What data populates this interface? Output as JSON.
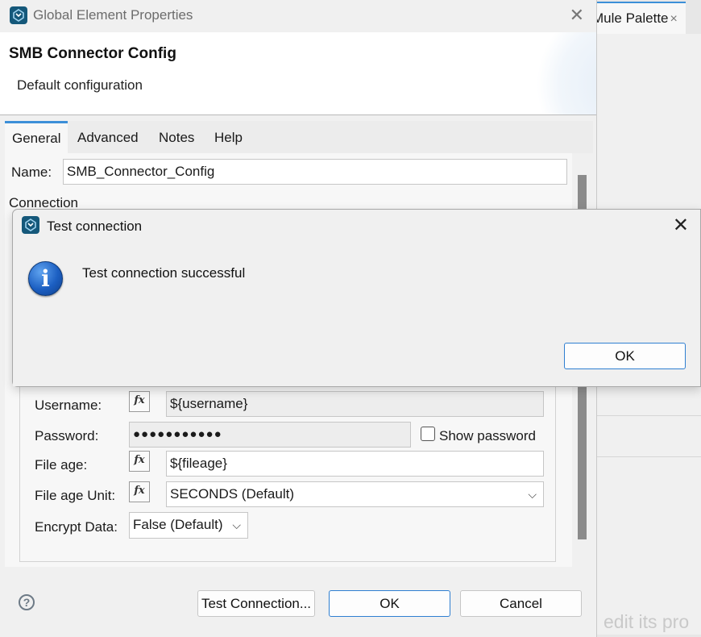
{
  "background": {
    "tab_label": "Mule Palette",
    "tab_close": "×",
    "watermark_text": "edit its pro"
  },
  "main_dialog": {
    "title": "Global Element Properties",
    "close_glyph": "✕",
    "header_title": "SMB Connector Config",
    "header_subtitle": "Default configuration",
    "tabs": [
      {
        "label": "General",
        "active": true
      },
      {
        "label": "Advanced",
        "active": false
      },
      {
        "label": "Notes",
        "active": false
      },
      {
        "label": "Help",
        "active": false
      }
    ],
    "name_label": "Name:",
    "name_value": "SMB_Connector_Config",
    "connection_label": "Connection",
    "fields": {
      "username_label": "Username:",
      "username_value": "${username}",
      "password_label": "Password:",
      "password_value": "●●●●●●●●●●●",
      "show_password_label": "Show password",
      "show_password_checked": false,
      "file_age_label": "File age:",
      "file_age_value": "${fileage}",
      "file_age_unit_label": "File age Unit:",
      "file_age_unit_value": "SECONDS (Default)",
      "encrypt_label": "Encrypt Data:",
      "encrypt_value": "False (Default)",
      "fx_text": "fx",
      "chevron": "⌵"
    },
    "buttons": {
      "help": "?",
      "test_connection": "Test Connection...",
      "ok": "OK",
      "cancel": "Cancel"
    }
  },
  "test_connection_dialog": {
    "title": "Test connection",
    "close_glyph": "✕",
    "message": "Test connection successful",
    "info_glyph": "i",
    "ok_label": "OK"
  },
  "colors": {
    "accent": "#3c8fd8",
    "app_icon": "#15587a",
    "info_blue": "#1c5fc2"
  }
}
